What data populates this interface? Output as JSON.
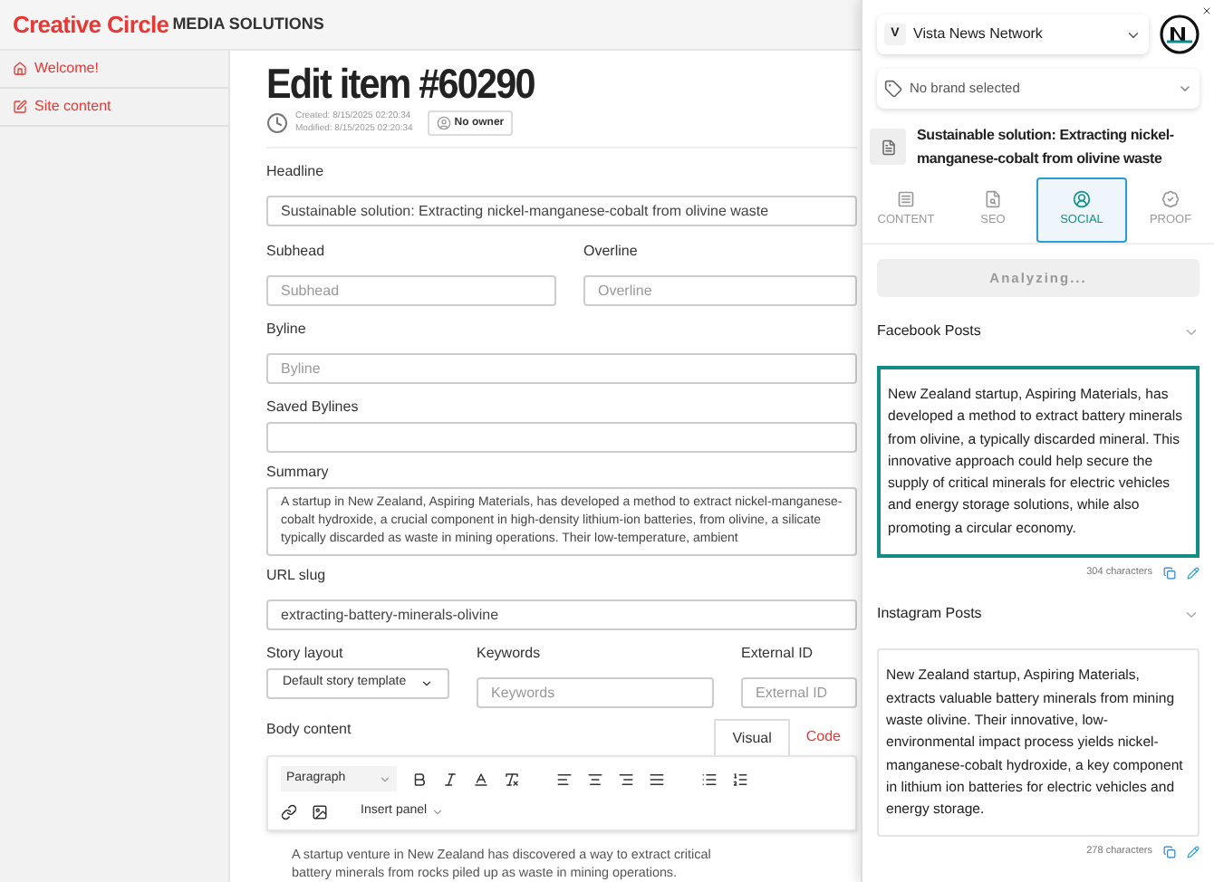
{
  "header": {
    "brand": "Creative Circle",
    "brand_suffix": "MEDIA SOLUTIONS"
  },
  "sidebar": {
    "items": [
      {
        "label": "Welcome!",
        "kind": "home",
        "selected": false
      },
      {
        "label": "Site content",
        "kind": "edit",
        "selected": false
      }
    ]
  },
  "editor": {
    "title": "Edit item #60290",
    "created": "Created: 8/15/2025 02:20:34",
    "modified": "Modified: 8/15/2025 02:20:34",
    "owner": "No owner",
    "headline": {
      "label": "Headline",
      "value": "Sustainable solution: Extracting nickel-manganese-cobalt from olivine waste"
    },
    "subhead": {
      "label": "Subhead",
      "placeholder": "Subhead"
    },
    "overline": {
      "label": "Overline",
      "placeholder": "Overline"
    },
    "byline": {
      "label": "Byline",
      "placeholder": "Byline"
    },
    "saved_bylines": {
      "label": "Saved Bylines"
    },
    "summary": {
      "label": "Summary",
      "value": "A startup in New Zealand, Aspiring Materials, has developed a method to extract nickel-manganese-cobalt hydroxide, a crucial component in high-density lithium-ion batteries, from olivine, a silicate typically discarded as waste in mining operations. Their low-temperature, ambient"
    },
    "url_slug": {
      "label": "URL slug",
      "value": "extracting-battery-minerals-olivine"
    },
    "story_layout": {
      "label": "Story layout",
      "value": "Default story template"
    },
    "keywords": {
      "label": "Keywords",
      "placeholder": "Keywords"
    },
    "external_id": {
      "label": "External ID",
      "placeholder": "External ID"
    },
    "body": {
      "label": "Body content",
      "tabs": [
        {
          "label": "Visual",
          "selected": true
        },
        {
          "label": "Code",
          "selected": false
        }
      ],
      "format": "Paragraph",
      "insert": "Insert panel",
      "text": "A startup venture in New Zealand has discovered a way to extract critical battery minerals from rocks piled up as waste in mining operations."
    }
  },
  "panel": {
    "network": {
      "initial": "V",
      "name": "Vista News Network"
    },
    "brand_placeholder": "No brand selected",
    "article_title": "Sustainable solution: Extracting nickel-manganese-cobalt from olivine waste",
    "tabs": [
      {
        "label": "CONTENT",
        "kind": "content",
        "selected": false
      },
      {
        "label": "SEO",
        "kind": "seo",
        "selected": false
      },
      {
        "label": "SOCIAL",
        "kind": "social",
        "selected": true
      },
      {
        "label": "PROOF",
        "kind": "proof",
        "selected": false
      }
    ],
    "status": "Analyzing...",
    "sections": [
      {
        "title": "Facebook Posts",
        "text": "New Zealand startup, Aspiring Materials, has developed a method to extract battery minerals from olivine, a typically discarded mineral. This innovative approach could help secure the supply of critical minerals for electric vehicles and energy storage solutions, while also promoting a circular economy.",
        "count": "304 characters",
        "selected": true
      },
      {
        "title": "Instagram Posts",
        "text": "New Zealand startup, Aspiring Materials, extracts valuable battery minerals from mining waste olivine. Their innovative, low-environmental impact process yields nickel-manganese-cobalt hydroxide, a key component in lithium ion batteries for electric vehicles and energy storage.",
        "count": "278 characters",
        "selected": false
      }
    ]
  }
}
